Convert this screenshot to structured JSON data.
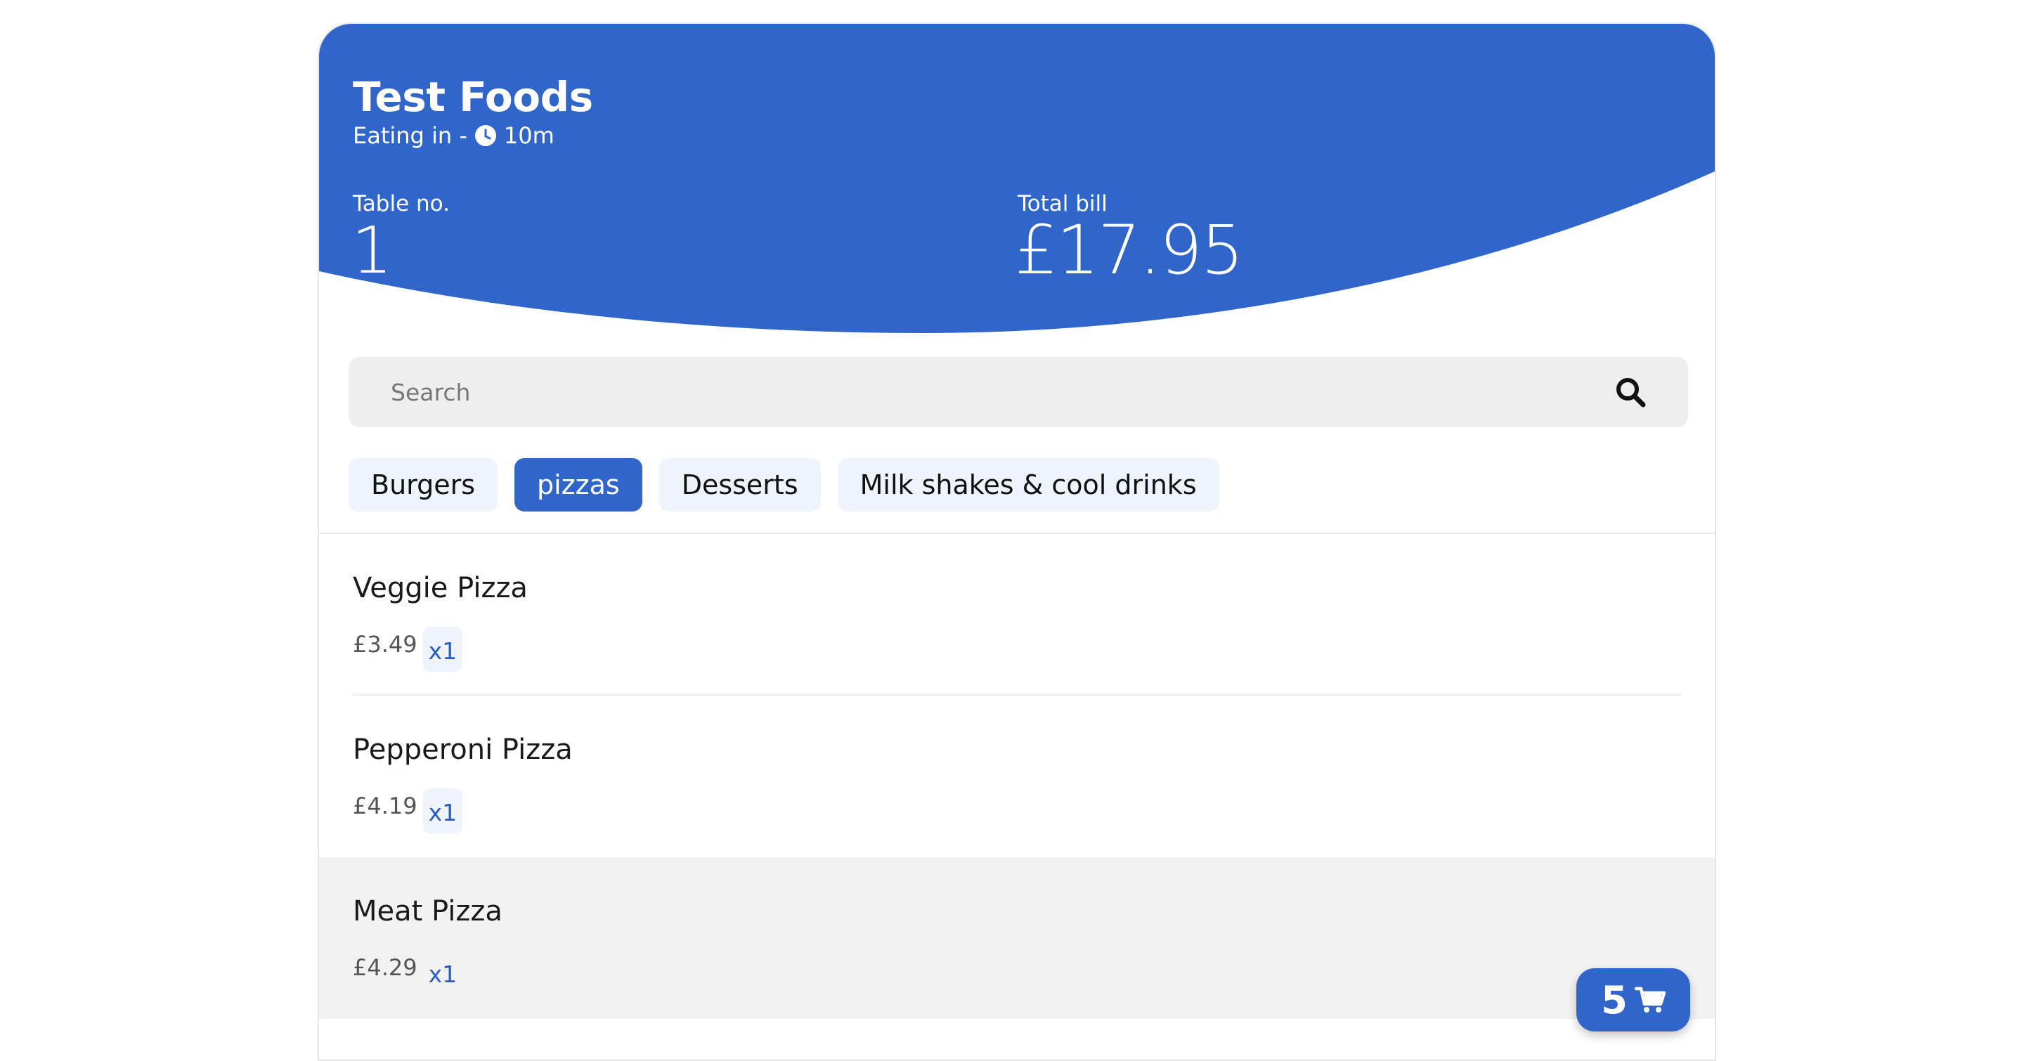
{
  "header": {
    "restaurant_name": "Test Foods",
    "mode": "Eating in -",
    "time": "10m",
    "table_label": "Table no.",
    "table_value": "1",
    "bill_label": "Total bill",
    "bill_value": "£17.95",
    "colors": {
      "brand_blue": "#3065ca"
    }
  },
  "search": {
    "placeholder": "Search",
    "value": ""
  },
  "tabs": [
    {
      "label": "Burgers",
      "active": false
    },
    {
      "label": "pizzas",
      "active": true
    },
    {
      "label": "Desserts",
      "active": false
    },
    {
      "label": "Milk shakes & cool drinks",
      "active": false
    }
  ],
  "items": [
    {
      "name": "Veggie Pizza",
      "price": "£3.49",
      "qty": "x1"
    },
    {
      "name": "Pepperoni Pizza",
      "price": "£4.19",
      "qty": "x1"
    },
    {
      "name": "Meat Pizza",
      "price": "£4.29",
      "qty": "x1"
    }
  ],
  "cart": {
    "count": "5",
    "icon": "cart-icon"
  }
}
